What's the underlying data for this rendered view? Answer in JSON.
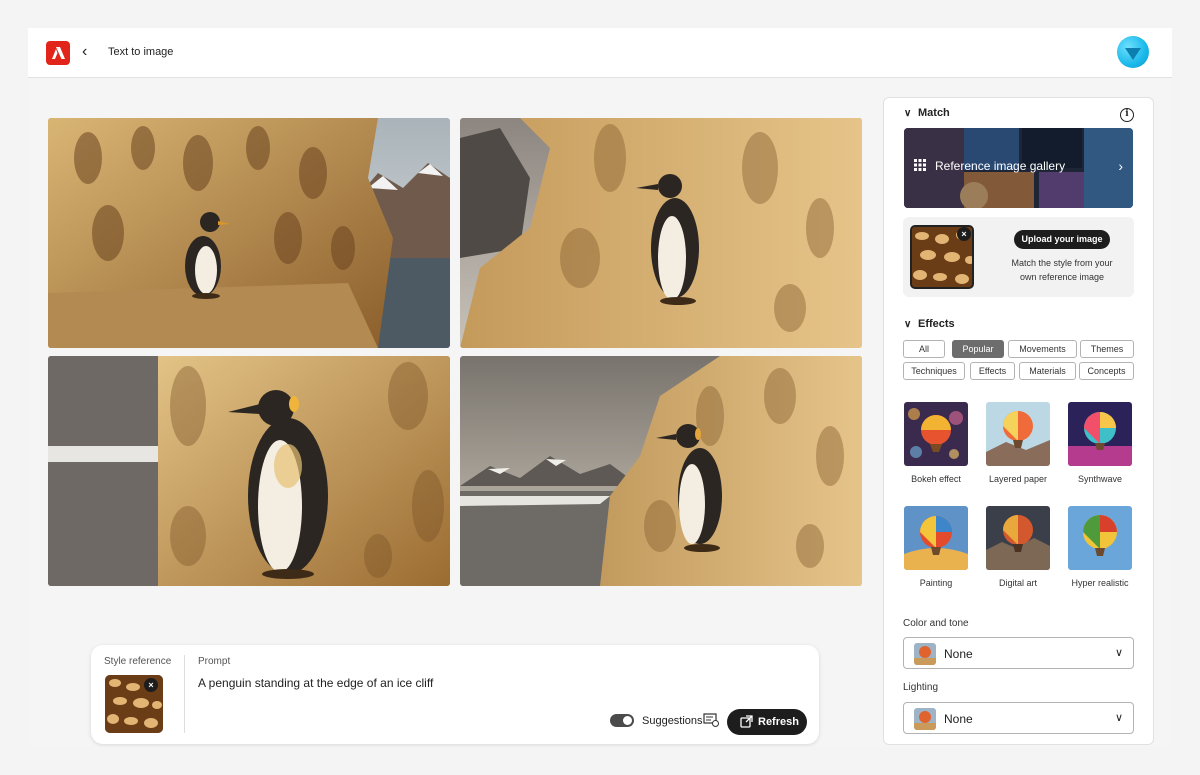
{
  "header": {
    "title": "Text to image",
    "back_icon": "chevron-left-icon",
    "logo": "adobe-firefly-logo",
    "avatar": "user-avatar"
  },
  "gallery": {
    "images": [
      {
        "name": "generated-image-1"
      },
      {
        "name": "generated-image-2"
      },
      {
        "name": "generated-image-3"
      },
      {
        "name": "generated-image-4"
      }
    ]
  },
  "prompt_bar": {
    "style_reference_label": "Style reference",
    "prompt_label": "Prompt",
    "prompt_text": "A penguin standing at the edge of an ice cliff",
    "suggestions_label": "Suggestions",
    "refresh_label": "Refresh"
  },
  "panel": {
    "match": {
      "heading": "Match",
      "gallery_label": "Reference image gallery",
      "upload_button": "Upload your image",
      "upload_description": "Match the style from your own reference image"
    },
    "effects": {
      "heading": "Effects",
      "filters": [
        "All",
        "Popular",
        "Movements",
        "Themes",
        "Techniques",
        "Effects",
        "Materials",
        "Concepts"
      ],
      "active_filter": "Popular",
      "items": [
        "Bokeh effect",
        "Layered paper",
        "Synthwave",
        "Painting",
        "Digital art",
        "Hyper realistic"
      ]
    },
    "color_and_tone": {
      "label": "Color and tone",
      "value": "None"
    },
    "lighting": {
      "label": "Lighting",
      "value": "None"
    }
  },
  "colors": {
    "accent": "#e1251b",
    "button_dark": "#1d1d1d",
    "chip_active": "#6d6d6d"
  }
}
